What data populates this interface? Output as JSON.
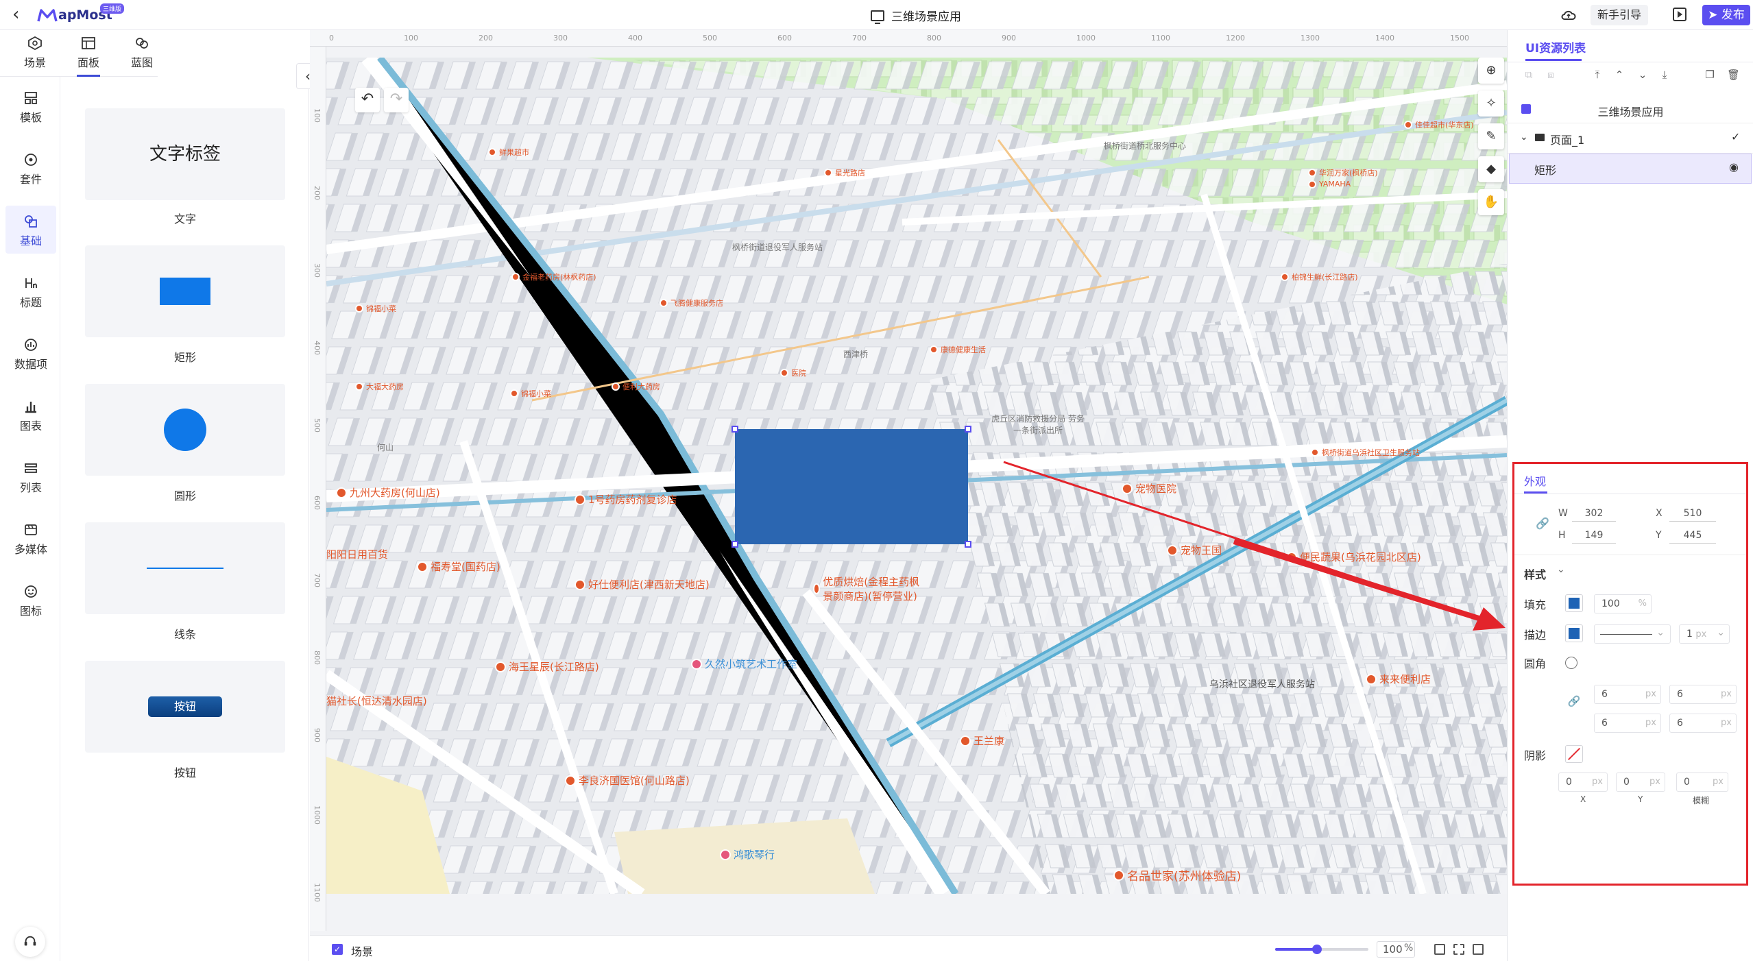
{
  "topbar": {
    "logo_text": "apMost",
    "logo_badge": "三维版",
    "app_title": "三维场景应用",
    "guide_label": "新手引导",
    "publish_label": "发布"
  },
  "rail_tabs": [
    {
      "label": "场景"
    },
    {
      "label": "面板"
    },
    {
      "label": "蓝图"
    }
  ],
  "nav": [
    {
      "label": "模板"
    },
    {
      "label": "套件"
    },
    {
      "label": "基础"
    },
    {
      "label": "标题"
    },
    {
      "label": "数据项"
    },
    {
      "label": "图表"
    },
    {
      "label": "列表"
    },
    {
      "label": "多媒体"
    },
    {
      "label": "图标"
    }
  ],
  "components": [
    {
      "preview_text": "文字标签",
      "label": "文字"
    },
    {
      "label": "矩形"
    },
    {
      "label": "圆形"
    },
    {
      "label": "线条"
    },
    {
      "preview_text": "按钮",
      "label": "按钮"
    }
  ],
  "rulers": {
    "top": [
      "0",
      "100",
      "200",
      "300",
      "400",
      "500",
      "600",
      "700",
      "800",
      "900",
      "1000",
      "1100",
      "1200",
      "1300",
      "1400",
      "1500"
    ],
    "left": [
      "100",
      "200",
      "300",
      "400",
      "500",
      "600",
      "700",
      "800",
      "900",
      "1000",
      "1100"
    ]
  },
  "map": {
    "pois": [
      {
        "text": "大福大药房",
        "color": "orange"
      },
      {
        "text": "锦福小菜",
        "color": "orange"
      },
      {
        "text": "便利大药房",
        "color": "orange"
      },
      {
        "text": "金福老药房(林枫药店)",
        "color": "orange"
      },
      {
        "text": "飞腾健康服务店",
        "color": "orange"
      },
      {
        "text": "西津桥",
        "color": "gray"
      },
      {
        "text": "医院",
        "color": "orange"
      },
      {
        "text": "康德健康生活",
        "color": "orange"
      },
      {
        "text": "九州大药房(何山店)",
        "color": "orange"
      },
      {
        "text": "1号药房药剂复诊店",
        "color": "orange"
      },
      {
        "text": "阳阳日用百货",
        "color": "orange"
      },
      {
        "text": "福寿堂(国药店)",
        "color": "orange"
      },
      {
        "text": "好仕便利店(津西新天地店)",
        "color": "orange"
      },
      {
        "text": "优质烘焙(金程主药枫景颜商店)(暂停营业)",
        "color": "orange"
      },
      {
        "text": "宠物王国",
        "color": "orange"
      },
      {
        "text": "海王星辰(长江路店)",
        "color": "orange"
      },
      {
        "text": "久然小筑艺术工作室",
        "color": "blue"
      },
      {
        "text": "猫社长(恒达清水园店)",
        "color": "orange"
      },
      {
        "text": "王兰康",
        "color": "orange"
      },
      {
        "text": "李良济国医馆(何山路店)",
        "color": "orange"
      },
      {
        "text": "鸿歌琴行",
        "color": "blue"
      },
      {
        "text": "名品世家(苏州体验店)",
        "color": "orange"
      },
      {
        "text": "来来便利店",
        "color": "orange"
      },
      {
        "text": "乌浜社区退役军人服务站",
        "color": "gray"
      },
      {
        "text": "宠物医院",
        "color": "orange"
      },
      {
        "text": "便民蔬果(乌浜花园北区店)",
        "color": "orange"
      },
      {
        "text": "枫桥街道乌浜社区卫生服务站",
        "color": "orange"
      },
      {
        "text": "虎丘区消防救援分局 劳务一条街派出所",
        "color": "gray"
      },
      {
        "text": "柏锦生鲜(长江路店)",
        "color": "orange"
      },
      {
        "text": "枫桥街道桥北服务中心",
        "color": "gray"
      },
      {
        "text": "华润万家(枫桥店)",
        "color": "orange"
      },
      {
        "text": "星光路店",
        "color": "orange"
      },
      {
        "text": "佳佳超市(华东店)",
        "color": "orange"
      },
      {
        "text": "鲜果超市",
        "color": "orange"
      },
      {
        "text": "YAMAHA",
        "color": "orange"
      },
      {
        "text": "枫桥街道退役军人服务站",
        "color": "gray"
      },
      {
        "text": "何山",
        "color": "gray"
      }
    ]
  },
  "bottom": {
    "scene_label": "场景",
    "zoom_value": "100",
    "zoom_unit": "%",
    "zoom_level": 0.45
  },
  "right_panel": {
    "tab": "UI资源列表",
    "tree": {
      "root": "三维场景应用",
      "page": "页面_1",
      "item": "矩形"
    },
    "appearance": {
      "title": "外观",
      "w_label": "W",
      "w": "302",
      "h_label": "H",
      "h": "149",
      "x_label": "X",
      "x": "510",
      "y_label": "Y",
      "y": "445",
      "style_label": "样式",
      "fill_label": "填充",
      "fill_color": "#1e63b5",
      "fill_opacity": "100",
      "fill_unit": "%",
      "stroke_label": "描边",
      "stroke_color": "#1e63b5",
      "stroke_width": "1",
      "px": "px",
      "radius_label": "圆角",
      "radius": [
        "6",
        "6",
        "6",
        "6"
      ],
      "shadow_label": "阴影",
      "shadow": [
        "0",
        "0",
        "0"
      ],
      "shadow_x_label": "X",
      "shadow_y_label": "Y",
      "shadow_blur_label": "模糊"
    }
  },
  "colors": {
    "accent": "#5b4ef0",
    "selected_rect": "#2b66b1",
    "highlight_box": "#e3242b"
  }
}
